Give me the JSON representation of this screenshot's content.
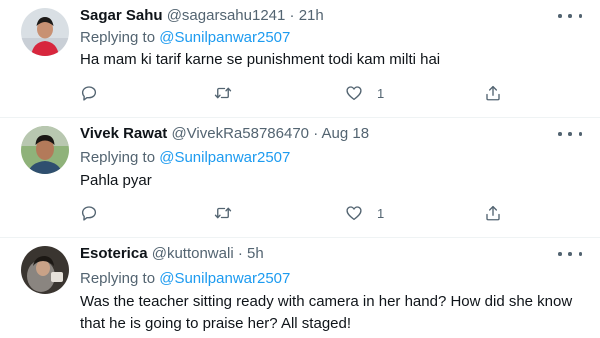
{
  "tweets": [
    {
      "name": "Sagar Sahu",
      "handle": "@sagarsahu1241",
      "separator": "·",
      "time": "21h",
      "replying_prefix": "Replying to",
      "replying_to": "@Sunilpanwar2507",
      "text": "Ha mam ki tarif karne se punishment todi kam milti hai",
      "like_count": "1",
      "icons": {
        "reply": "reply-icon",
        "retweet": "retweet-icon",
        "like": "heart-icon",
        "share": "share-icon",
        "more": "more-options-icon"
      }
    },
    {
      "name": "Vivek Rawat",
      "handle": "@VivekRa58786470",
      "separator": "·",
      "time": "Aug 18",
      "replying_prefix": "Replying to",
      "replying_to": "@Sunilpanwar2507",
      "text": "Pahla pyar",
      "like_count": "1",
      "icons": {
        "reply": "reply-icon",
        "retweet": "retweet-icon",
        "like": "heart-icon",
        "share": "share-icon",
        "more": "more-options-icon"
      }
    },
    {
      "name": "Esoterica",
      "handle": "@kuttonwali",
      "separator": "·",
      "time": "5h",
      "replying_prefix": "Replying to",
      "replying_to": "@Sunilpanwar2507",
      "text_lines": [
        "Was the teacher sitting ready with camera in her hand? How did she know",
        "that he is going to praise her? All staged!"
      ],
      "icons": {
        "more": "more-options-icon"
      }
    }
  ],
  "colors": {
    "text": "#0f1419",
    "secondary": "#536471",
    "link": "#1d9bf0",
    "divider": "#eff3f4"
  }
}
